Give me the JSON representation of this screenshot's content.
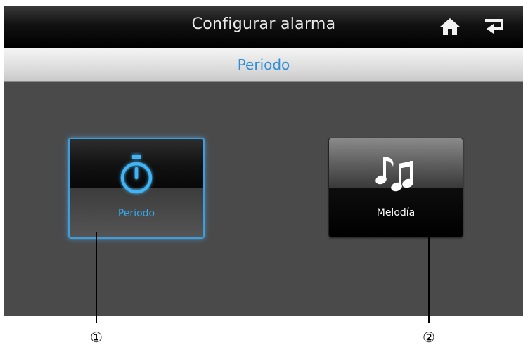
{
  "header": {
    "title": "Configurar alarma",
    "home_icon": "home-icon",
    "back_icon": "back-arrow-icon"
  },
  "subheader": {
    "title": "Periodo",
    "color": "#2e8fd8"
  },
  "tiles": [
    {
      "label": "Periodo",
      "icon": "stopwatch-icon",
      "selected": true,
      "accent": "#35a8ea"
    },
    {
      "label": "Melodía",
      "icon": "music-notes-icon",
      "selected": false
    }
  ],
  "callouts": [
    "①",
    "②"
  ]
}
